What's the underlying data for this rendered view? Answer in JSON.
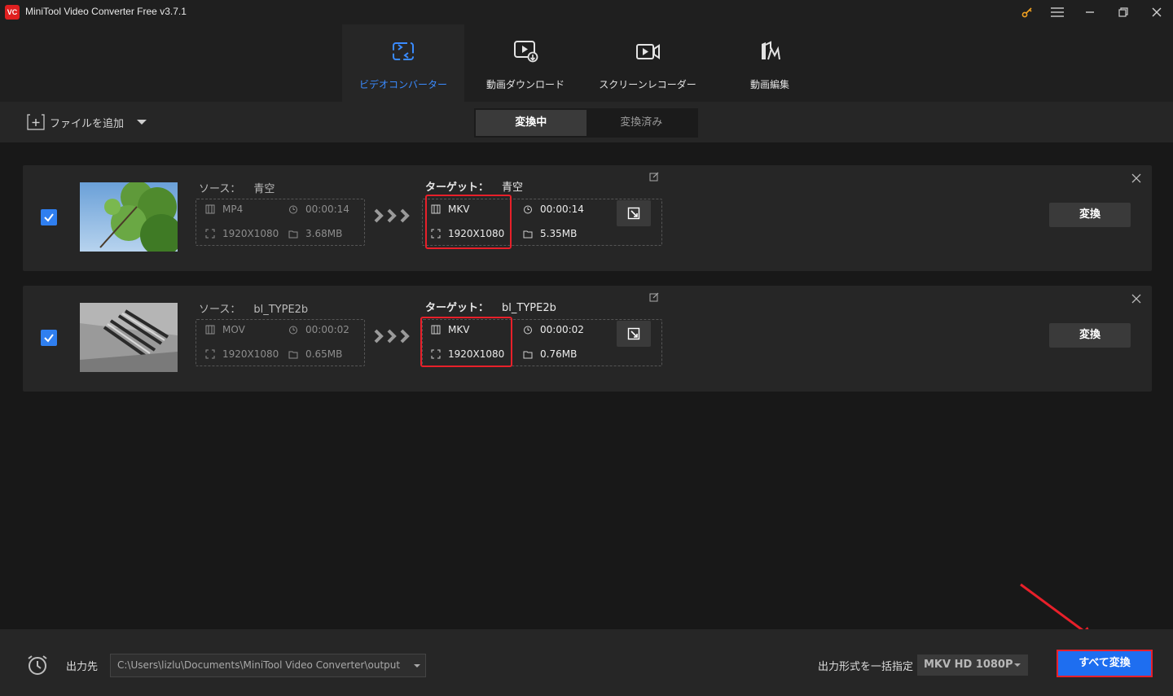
{
  "app": {
    "logo_text": "VC",
    "title": "MiniTool Video Converter Free v3.7.1"
  },
  "nav": {
    "tabs": [
      {
        "label": "ビデオコンバーター",
        "icon": "convert-icon",
        "active": true
      },
      {
        "label": "動画ダウンロード",
        "icon": "download-icon",
        "active": false
      },
      {
        "label": "スクリーンレコーダー",
        "icon": "recorder-icon",
        "active": false
      },
      {
        "label": "動画編集",
        "icon": "editor-icon",
        "active": false
      }
    ]
  },
  "toolbar": {
    "add_file_label": "ファイルを追加",
    "seg_converting": "変換中",
    "seg_converted": "変換済み"
  },
  "tasks": [
    {
      "checked": true,
      "source_label": "ソース：",
      "source_name": "青空",
      "source_format": "MP4",
      "source_duration": "00:00:14",
      "source_resolution": "1920X1080",
      "source_size": "3.68MB",
      "target_label": "ターゲット：",
      "target_name": "青空",
      "target_format": "MKV",
      "target_duration": "00:00:14",
      "target_resolution": "1920X1080",
      "target_size": "5.35MB",
      "convert_label": "変換"
    },
    {
      "checked": true,
      "source_label": "ソース：",
      "source_name": "bl_TYPE2b",
      "source_format": "MOV",
      "source_duration": "00:00:02",
      "source_resolution": "1920X1080",
      "source_size": "0.65MB",
      "target_label": "ターゲット：",
      "target_name": "bl_TYPE2b",
      "target_format": "MKV",
      "target_duration": "00:00:02",
      "target_resolution": "1920X1080",
      "target_size": "0.76MB",
      "convert_label": "変換"
    }
  ],
  "bottom": {
    "output_label": "出力先",
    "output_path": "C:\\Users\\lizlu\\Documents\\MiniTool Video Converter\\output",
    "format_label": "出力形式を一括指定",
    "format_value": "MKV HD 1080P",
    "convert_all_label": "すべて変換"
  },
  "colors": {
    "accent": "#3a8bff",
    "primary_button": "#1e6ef0",
    "highlight_box": "#e8202a",
    "key_icon": "#f0a020"
  }
}
